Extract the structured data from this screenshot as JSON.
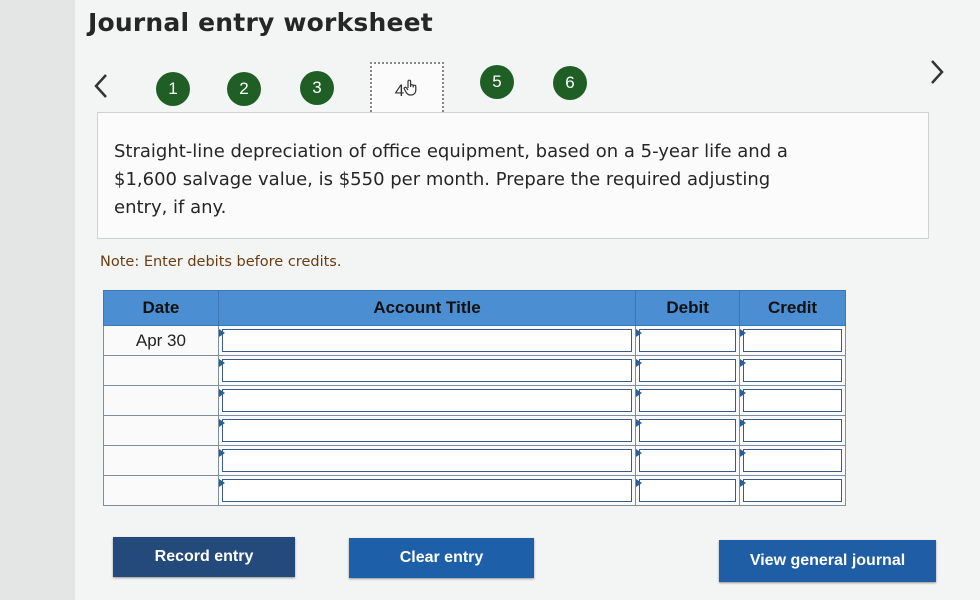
{
  "page": {
    "title": "Journal entry worksheet"
  },
  "steps": {
    "items": [
      "1",
      "2",
      "3",
      "4",
      "5",
      "6"
    ],
    "current": "4"
  },
  "question": {
    "text": "Straight-line depreciation of office equipment, based on a 5-year life and a $1,600 salvage value, is $550 per month. Prepare the required adjusting entry, if any."
  },
  "note": "Note: Enter debits before credits.",
  "journal": {
    "headers": {
      "date": "Date",
      "account": "Account Title",
      "debit": "Debit",
      "credit": "Credit"
    },
    "rows": [
      {
        "date": "Apr 30",
        "account": "",
        "debit": "",
        "credit": ""
      },
      {
        "date": "",
        "account": "",
        "debit": "",
        "credit": ""
      },
      {
        "date": "",
        "account": "",
        "debit": "",
        "credit": ""
      },
      {
        "date": "",
        "account": "",
        "debit": "",
        "credit": ""
      },
      {
        "date": "",
        "account": "",
        "debit": "",
        "credit": ""
      },
      {
        "date": "",
        "account": "",
        "debit": "",
        "credit": ""
      }
    ]
  },
  "buttons": {
    "record": "Record entry",
    "clear": "Clear entry",
    "view_journal": "View general journal"
  },
  "colors": {
    "step_badge": "#1f5f25",
    "header": "#4b8ed2",
    "button": "#1e5aa3"
  },
  "icons": {
    "prev": "chevron-left-icon",
    "next": "chevron-right-icon",
    "pointer": "hand-pointer-icon"
  }
}
